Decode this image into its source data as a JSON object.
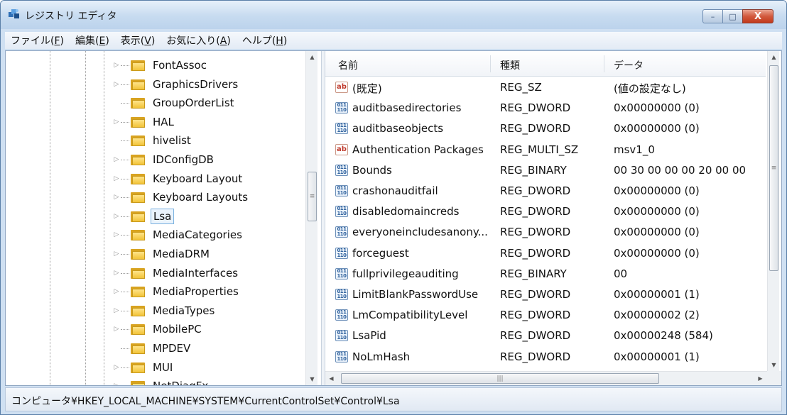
{
  "window": {
    "title": "レジストリ エディタ",
    "min_label": "–",
    "max_label": "□",
    "close_label": "X"
  },
  "menu": [
    {
      "label": "ファイル(",
      "key": "F",
      "tail": ")"
    },
    {
      "label": "編集(",
      "key": "E",
      "tail": ")"
    },
    {
      "label": "表示(",
      "key": "V",
      "tail": ")"
    },
    {
      "label": "お気に入り(",
      "key": "A",
      "tail": ")"
    },
    {
      "label": "ヘルプ(",
      "key": "H",
      "tail": ")"
    }
  ],
  "tree": {
    "items": [
      {
        "label": "FontAssoc",
        "expandable": true
      },
      {
        "label": "GraphicsDrivers",
        "expandable": true
      },
      {
        "label": "GroupOrderList",
        "expandable": false
      },
      {
        "label": "HAL",
        "expandable": true
      },
      {
        "label": "hivelist",
        "expandable": false
      },
      {
        "label": "IDConfigDB",
        "expandable": true
      },
      {
        "label": "Keyboard Layout",
        "expandable": true
      },
      {
        "label": "Keyboard Layouts",
        "expandable": true
      },
      {
        "label": "Lsa",
        "expandable": true,
        "selected": true
      },
      {
        "label": "MediaCategories",
        "expandable": true
      },
      {
        "label": "MediaDRM",
        "expandable": true
      },
      {
        "label": "MediaInterfaces",
        "expandable": true
      },
      {
        "label": "MediaProperties",
        "expandable": true
      },
      {
        "label": "MediaTypes",
        "expandable": true
      },
      {
        "label": "MobilePC",
        "expandable": true
      },
      {
        "label": "MPDEV",
        "expandable": false
      },
      {
        "label": "MUI",
        "expandable": true
      },
      {
        "label": "NetDiagFx",
        "expandable": true
      }
    ]
  },
  "list": {
    "columns": [
      "名前",
      "種類",
      "データ"
    ],
    "rows": [
      {
        "icon": "ab",
        "name": "(既定)",
        "type": "REG_SZ",
        "data": "(値の設定なし)"
      },
      {
        "icon": "bin",
        "name": "auditbasedirectories",
        "type": "REG_DWORD",
        "data": "0x00000000 (0)"
      },
      {
        "icon": "bin",
        "name": "auditbaseobjects",
        "type": "REG_DWORD",
        "data": "0x00000000 (0)"
      },
      {
        "icon": "ab",
        "name": "Authentication Packages",
        "type": "REG_MULTI_SZ",
        "data": "msv1_0"
      },
      {
        "icon": "bin",
        "name": "Bounds",
        "type": "REG_BINARY",
        "data": "00 30 00 00 00 20 00 00"
      },
      {
        "icon": "bin",
        "name": "crashonauditfail",
        "type": "REG_DWORD",
        "data": "0x00000000 (0)"
      },
      {
        "icon": "bin",
        "name": "disabledomaincreds",
        "type": "REG_DWORD",
        "data": "0x00000000 (0)"
      },
      {
        "icon": "bin",
        "name": "everyoneincludesanony...",
        "type": "REG_DWORD",
        "data": "0x00000000 (0)"
      },
      {
        "icon": "bin",
        "name": "forceguest",
        "type": "REG_DWORD",
        "data": "0x00000000 (0)"
      },
      {
        "icon": "bin",
        "name": "fullprivilegeauditing",
        "type": "REG_BINARY",
        "data": "00"
      },
      {
        "icon": "bin",
        "name": "LimitBlankPasswordUse",
        "type": "REG_DWORD",
        "data": "0x00000001 (1)"
      },
      {
        "icon": "bin",
        "name": "LmCompatibilityLevel",
        "type": "REG_DWORD",
        "data": "0x00000002 (2)"
      },
      {
        "icon": "bin",
        "name": "LsaPid",
        "type": "REG_DWORD",
        "data": "0x00000248 (584)"
      },
      {
        "icon": "bin",
        "name": "NoLmHash",
        "type": "REG_DWORD",
        "data": "0x00000001 (1)"
      }
    ]
  },
  "icon_text": {
    "ab": "ab",
    "bin": "011\n110"
  },
  "status": {
    "path": "コンピュータ¥HKEY_LOCAL_MACHINE¥SYSTEM¥CurrentControlSet¥Control¥Lsa"
  },
  "colors": {
    "titlebar": "#c7dbf0",
    "close_button": "#c1391b",
    "folder": "#f2c338",
    "selection_border": "#7db3e0"
  }
}
